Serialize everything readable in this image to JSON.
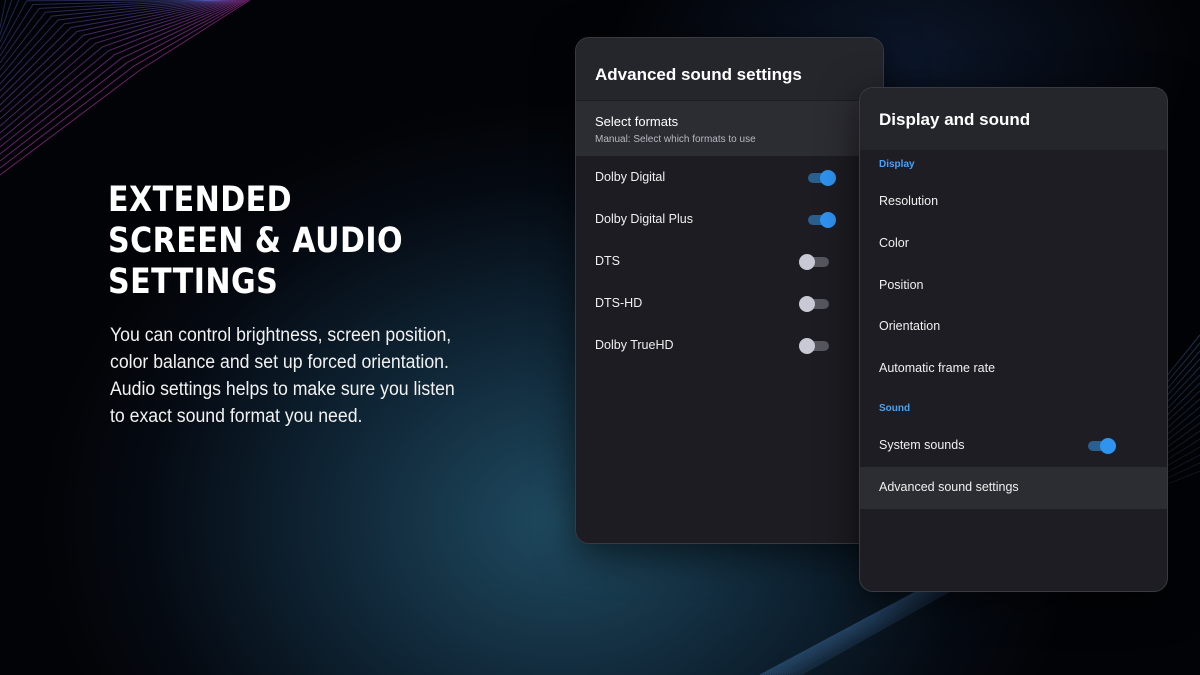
{
  "headline": {
    "lines": [
      "EXTENDED",
      "SCREEN & AUDIO",
      "SETTINGS"
    ]
  },
  "description": {
    "lines": [
      "You can control brightness, screen position,",
      "color balance and set up forced orientation.",
      "Audio settings helps to make sure you listen",
      "to exact sound format you need."
    ]
  },
  "advanced_panel": {
    "title": "Advanced sound settings",
    "select_formats": {
      "title": "Select formats",
      "subtitle": "Manual: Select which formats to use"
    },
    "formats": [
      {
        "label": "Dolby Digital",
        "enabled": true
      },
      {
        "label": "Dolby Digital Plus",
        "enabled": true
      },
      {
        "label": "DTS",
        "enabled": false
      },
      {
        "label": "DTS-HD",
        "enabled": false
      },
      {
        "label": "Dolby TrueHD",
        "enabled": false
      }
    ]
  },
  "display_panel": {
    "title": "Display and sound",
    "display_section": "Display",
    "display_items": [
      "Resolution",
      "Color",
      "Position",
      "Orientation",
      "Automatic frame rate"
    ],
    "sound_section": "Sound",
    "system_sounds": {
      "label": "System sounds",
      "enabled": true
    },
    "advanced_item": "Advanced sound settings"
  },
  "colors": {
    "accent": "#2f93f0",
    "section_label": "#4aa3f0",
    "panel_bg": "#1c1c22",
    "panel_header": "#25252c",
    "highlight_row": "#2c2c33"
  }
}
